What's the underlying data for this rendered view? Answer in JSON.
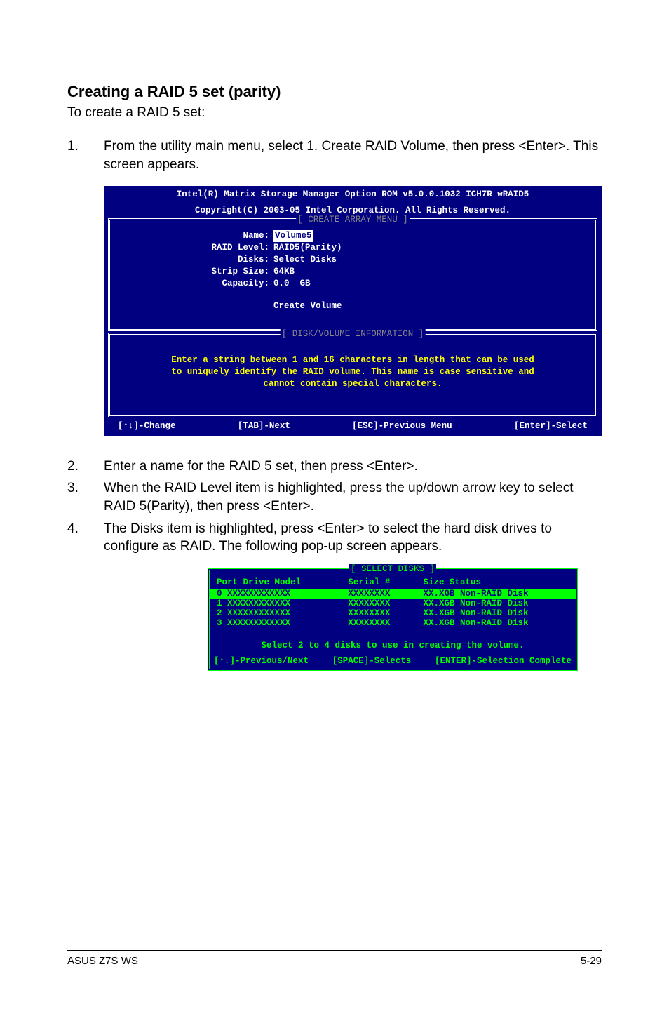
{
  "heading": "Creating a RAID 5 set (parity)",
  "intro": "To create a RAID 5 set:",
  "step1": {
    "num": "1.",
    "text": "From the utility main menu, select 1. Create RAID Volume, then press <Enter>. This screen appears."
  },
  "bios1": {
    "header1": "Intel(R) Matrix Storage Manager Option ROM v5.0.0.1032 ICH7R wRAID5",
    "header2": "Copyright(C) 2003-05 Intel Corporation. All Rights Reserved.",
    "create_title": "[ CREATE ARRAY MENU ]",
    "fields": {
      "name_lbl": "Name:",
      "name_val": "Volume5",
      "raid_lbl": "RAID Level:",
      "raid_val": "RAID5(Parity)",
      "disks_lbl": "Disks:",
      "disks_val": "Select Disks",
      "strip_lbl": "Strip Size:",
      "strip_val": "64KB",
      "cap_lbl": "Capacity:",
      "cap_val": "0.0  GB"
    },
    "create_volume": "Create Volume",
    "info_title": "[ DISK/VOLUME INFORMATION ]",
    "info_l1": "Enter a string between 1 and 16 characters in length that can be used",
    "info_l2": "to uniquely identify the RAID volume. This name is case sensitive and",
    "info_l3": "cannot contain special characters.",
    "footer": {
      "change": "[↑↓]-Change",
      "tab": "[TAB]-Next",
      "esc": "[ESC]-Previous Menu",
      "enter": "[Enter]-Select"
    }
  },
  "step2": {
    "num": "2.",
    "text": "Enter a name for the RAID 5 set, then press <Enter>."
  },
  "step3": {
    "num": "3.",
    "text": "When the RAID Level item is highlighted, press the up/down arrow key to select RAID 5(Parity), then press <Enter>."
  },
  "step4": {
    "num": "4.",
    "text": "The Disks item is highlighted, press <Enter> to select the hard disk drives to configure as RAID. The following pop-up screen appears."
  },
  "bios2": {
    "title": "[ SELECT DISKS ]",
    "head": {
      "port": "Port",
      "model": "Drive Model",
      "serial": "Serial #",
      "size": "Size",
      "status": "Status"
    },
    "rows": [
      {
        "port": "0",
        "model": "XXXXXXXXXXXX",
        "serial": "XXXXXXXX",
        "size": "XX.XGB",
        "status": "Non-RAID Disk"
      },
      {
        "port": "1",
        "model": "XXXXXXXXXXXX",
        "serial": "XXXXXXXX",
        "size": "XX.XGB",
        "status": "Non-RAID Disk"
      },
      {
        "port": "2",
        "model": "XXXXXXXXXXXX",
        "serial": "XXXXXXXX",
        "size": "XX.XGB",
        "status": "Non-RAID Disk"
      },
      {
        "port": "3",
        "model": "XXXXXXXXXXXX",
        "serial": "XXXXXXXX",
        "size": "XX.XGB",
        "status": "Non-RAID Disk"
      }
    ],
    "select_line": "Select 2 to 4 disks to use in creating the volume.",
    "footer": {
      "prev": "[↑↓]-Previous/Next",
      "space": "[SPACE]-Selects",
      "enter": "[ENTER]-Selection Complete"
    }
  },
  "pagefooter": {
    "left": "ASUS Z7S WS",
    "right": "5-29"
  }
}
